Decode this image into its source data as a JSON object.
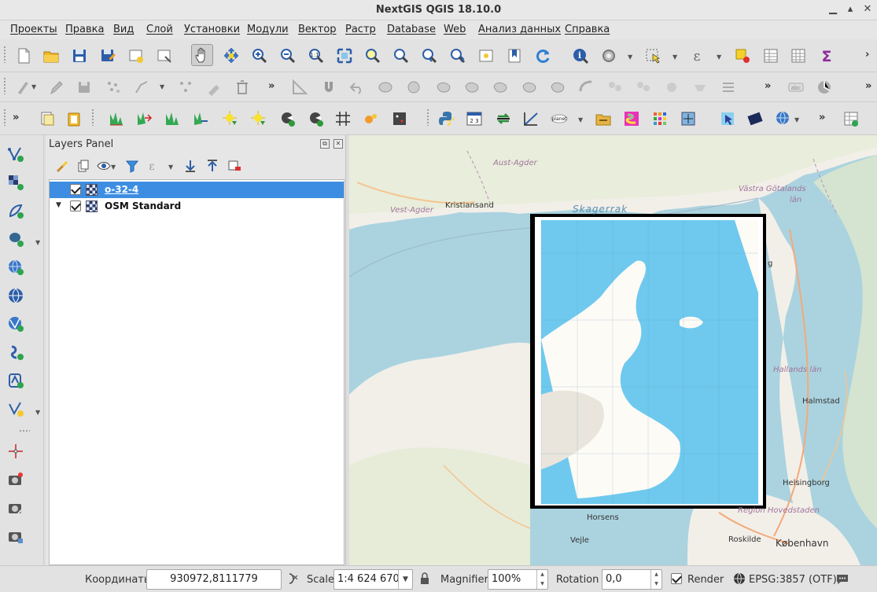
{
  "window": {
    "title": "NextGIS QGIS 18.10.0"
  },
  "menu": [
    "Проекты",
    "Правка",
    "Вид",
    "Слой",
    "Установки",
    "Модули",
    "Вектор",
    "Растр",
    "Database",
    "Web",
    "Анализ данных",
    "Справка"
  ],
  "panel": {
    "title": "Layers Panel",
    "layers": [
      {
        "name": "o-32-4",
        "checked": true,
        "selected": true
      },
      {
        "name": "OSM Standard",
        "checked": true,
        "selected": false
      }
    ]
  },
  "map": {
    "labels": {
      "aust_agder": "Aust-Agder",
      "vest_agder": "Vest-Agder",
      "kristiansand": "Kristiansand",
      "skagerrak": "Skagerrak",
      "vastra_gotaland": "Västra Götalands",
      "lan": "län",
      "halland": "Hallands län",
      "halmstad": "Halmstad",
      "helsingborg": "Helsingborg",
      "hovedstaden": "Region Hovedstaden",
      "horsens": "Horsens",
      "vejle": "Vejle",
      "roskilde": "Roskilde",
      "kobenhavn": "København",
      "g": "g"
    }
  },
  "status": {
    "coord_label": "Координаты",
    "coord_value": "930972,8111779",
    "scale_label": "Scale",
    "scale_value": "1:4 624 670",
    "magnifier_label": "Magnifier",
    "magnifier_value": "100%",
    "rotation_label": "Rotation",
    "rotation_value": "0,0",
    "render_label": "Render",
    "crs": "EPSG:3857 (OTF)"
  }
}
